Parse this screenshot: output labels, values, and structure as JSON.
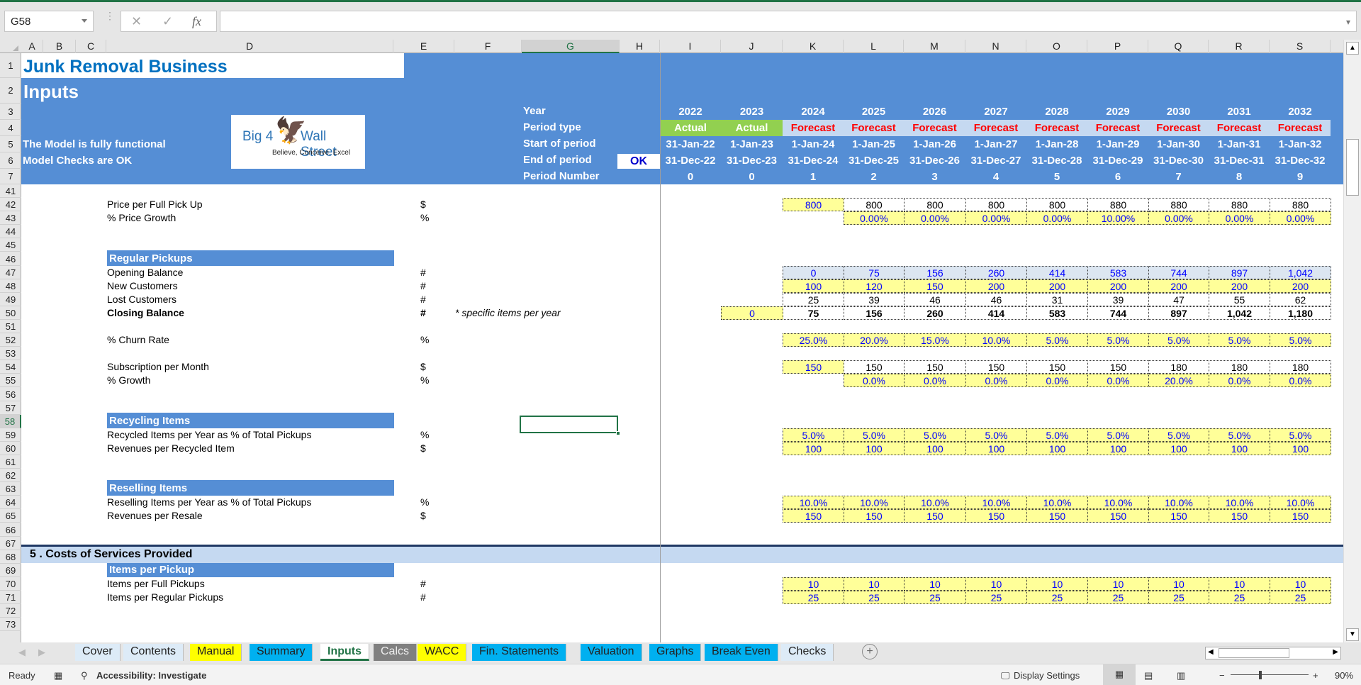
{
  "formula_bar": {
    "name_box": "G58",
    "cancel_icon": "✕",
    "enter_icon": "✓",
    "fx_label": "fx",
    "formula": ""
  },
  "columns": [
    "A",
    "B",
    "C",
    "D",
    "E",
    "F",
    "G",
    "H",
    "I",
    "J",
    "K",
    "L",
    "M",
    "N",
    "O",
    "P",
    "Q",
    "R",
    "S"
  ],
  "rows": [
    "1",
    "2",
    "3",
    "4",
    "5",
    "6",
    "7",
    "41",
    "42",
    "43",
    "44",
    "45",
    "46",
    "47",
    "48",
    "49",
    "50",
    "51",
    "52",
    "53",
    "54",
    "55",
    "56",
    "57",
    "58",
    "59",
    "60",
    "61",
    "62",
    "63",
    "64",
    "65",
    "66",
    "67",
    "68",
    "69",
    "70",
    "71",
    "72",
    "73"
  ],
  "header": {
    "title": "Junk Removal Business",
    "subtitle": "Inputs",
    "status_line1": "The Model is fully functional",
    "status_line2": "Model Checks are OK",
    "logo": {
      "brand_left": "Big 4",
      "brand_right": "Wall Street",
      "tagline": "Believe, Conceive, Excel"
    },
    "row_labels": [
      "Year",
      "Period type",
      "Start of period",
      "End of period",
      "Period Number"
    ],
    "check_value": "OK",
    "years": [
      "2022",
      "2023",
      "2024",
      "2025",
      "2026",
      "2027",
      "2028",
      "2029",
      "2030",
      "2031",
      "2032"
    ],
    "period_types": [
      "Actual",
      "Actual",
      "Forecast",
      "Forecast",
      "Forecast",
      "Forecast",
      "Forecast",
      "Forecast",
      "Forecast",
      "Forecast",
      "Forecast"
    ],
    "start_dates": [
      "31-Jan-22",
      "1-Jan-23",
      "1-Jan-24",
      "1-Jan-25",
      "1-Jan-26",
      "1-Jan-27",
      "1-Jan-28",
      "1-Jan-29",
      "1-Jan-30",
      "1-Jan-31",
      "1-Jan-32"
    ],
    "end_dates": [
      "31-Dec-22",
      "31-Dec-23",
      "31-Dec-24",
      "31-Dec-25",
      "31-Dec-26",
      "31-Dec-27",
      "31-Dec-28",
      "31-Dec-29",
      "31-Dec-30",
      "31-Dec-31",
      "31-Dec-32"
    ],
    "period_numbers": [
      "0",
      "0",
      "1",
      "2",
      "3",
      "4",
      "5",
      "6",
      "7",
      "8",
      "9"
    ]
  },
  "lines": {
    "price_full": {
      "label": "Price per Full Pick Up",
      "unit": "$",
      "values": [
        "800",
        "800",
        "800",
        "800",
        "800",
        "880",
        "880",
        "880",
        "880"
      ]
    },
    "price_growth": {
      "label": "% Price Growth",
      "unit": "%",
      "values": [
        "0.00%",
        "0.00%",
        "0.00%",
        "0.00%",
        "10.00%",
        "0.00%",
        "0.00%",
        "0.00%"
      ]
    },
    "regular_pickups": {
      "title": "Regular Pickups"
    },
    "opening": {
      "label": "Opening Balance",
      "unit": "#",
      "values": [
        "0",
        "75",
        "156",
        "260",
        "414",
        "583",
        "744",
        "897",
        "1,042"
      ]
    },
    "new_customers": {
      "label": "New Customers",
      "unit": "#",
      "values": [
        "100",
        "120",
        "150",
        "200",
        "200",
        "200",
        "200",
        "200",
        "200"
      ]
    },
    "lost_customers": {
      "label": "Lost Customers",
      "unit": "#",
      "values": [
        "25",
        "39",
        "46",
        "46",
        "31",
        "39",
        "47",
        "55",
        "62"
      ]
    },
    "closing": {
      "label": "Closing Balance",
      "unit": "#",
      "note": "* specific items per year",
      "initial": "0",
      "values": [
        "75",
        "156",
        "260",
        "414",
        "583",
        "744",
        "897",
        "1,042",
        "1,180"
      ]
    },
    "churn": {
      "label": "% Churn Rate",
      "unit": "%",
      "values": [
        "25.0%",
        "20.0%",
        "15.0%",
        "10.0%",
        "5.0%",
        "5.0%",
        "5.0%",
        "5.0%",
        "5.0%"
      ]
    },
    "subscription": {
      "label": "Subscription per Month",
      "unit": "$",
      "values": [
        "150",
        "150",
        "150",
        "150",
        "150",
        "150",
        "180",
        "180",
        "180"
      ]
    },
    "sub_growth": {
      "label": "% Growth",
      "unit": "%",
      "values": [
        "0.0%",
        "0.0%",
        "0.0%",
        "0.0%",
        "0.0%",
        "20.0%",
        "0.0%",
        "0.0%"
      ]
    },
    "recycling": {
      "title": "Recycling Items"
    },
    "recycled_pct": {
      "label": "Recycled Items per Year as % of Total Pickups",
      "unit": "%",
      "values": [
        "5.0%",
        "5.0%",
        "5.0%",
        "5.0%",
        "5.0%",
        "5.0%",
        "5.0%",
        "5.0%",
        "5.0%"
      ]
    },
    "recycled_rev": {
      "label": "Revenues per Recycled Item",
      "unit": "$",
      "values": [
        "100",
        "100",
        "100",
        "100",
        "100",
        "100",
        "100",
        "100",
        "100"
      ]
    },
    "reselling": {
      "title": "Reselling Items"
    },
    "resell_pct": {
      "label": "Reselling Items per Year as % of Total Pickups",
      "unit": "%",
      "values": [
        "10.0%",
        "10.0%",
        "10.0%",
        "10.0%",
        "10.0%",
        "10.0%",
        "10.0%",
        "10.0%",
        "10.0%"
      ]
    },
    "resell_rev": {
      "label": "Revenues per Resale",
      "unit": "$",
      "values": [
        "150",
        "150",
        "150",
        "150",
        "150",
        "150",
        "150",
        "150",
        "150"
      ]
    },
    "costs_section": {
      "title": "5 . Costs of Services Provided"
    },
    "items_per_pickup": {
      "title": "Items per Pickup"
    },
    "items_full": {
      "label": "Items per Full Pickups",
      "unit": "#",
      "values": [
        "10",
        "10",
        "10",
        "10",
        "10",
        "10",
        "10",
        "10",
        "10"
      ]
    },
    "items_regular": {
      "label": "Items per Regular Pickups",
      "unit": "#",
      "values": [
        "25",
        "25",
        "25",
        "25",
        "25",
        "25",
        "25",
        "25",
        "25"
      ]
    }
  },
  "sheet_tabs": [
    {
      "label": "Cover",
      "color": "#ddebf7"
    },
    {
      "label": "Contents",
      "color": "#ddebf7"
    },
    {
      "label": "Manual",
      "color": "#ffff00"
    },
    {
      "label": "Summary",
      "color": "#00b0f0"
    },
    {
      "label": "Inputs",
      "color": "#ffffff",
      "active": true
    },
    {
      "label": "Calcs",
      "color": "#808080"
    },
    {
      "label": "WACC",
      "color": "#ffff00"
    },
    {
      "label": "Fin. Statements",
      "color": "#00b0f0"
    },
    {
      "label": "Valuation",
      "color": "#00b0f0"
    },
    {
      "label": "Graphs",
      "color": "#00b0f0"
    },
    {
      "label": "Break Even",
      "color": "#00b0f0"
    },
    {
      "label": "Checks",
      "color": "#ddebf7"
    }
  ],
  "status_bar": {
    "ready": "Ready",
    "accessibility": "Accessibility: Investigate",
    "display_settings": "Display Settings",
    "zoom": "90%"
  },
  "colors": {
    "excel_green": "#217346",
    "header_blue": "#558ed5",
    "input_yellow": "#ffff99",
    "forecast_red": "#ff0000",
    "actual_green": "#92d050"
  }
}
